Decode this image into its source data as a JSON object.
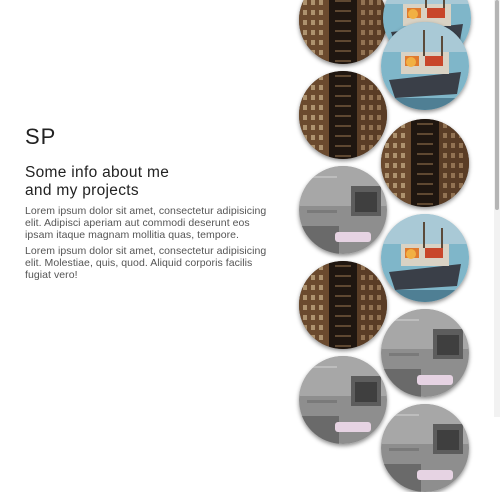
{
  "intro": {
    "initials": "SP",
    "subtitle_line1": "Some info about me",
    "subtitle_line2": "and my projects",
    "paragraph1": "Lorem ipsum dolor sit amet, consectetur adipisicing elit. Adipisci aperiam aut commodi deserunt eos ipsam itaque magnam mollitia quas, tempore.",
    "paragraph2": "Lorem ipsum dolor sit amet, consectetur adipisicing elit. Molestiae, quis, quod. Aliquid corporis facilis fugiat vero!"
  },
  "gallery": {
    "images": [
      {
        "name": "building-photo-1",
        "kind": "building"
      },
      {
        "name": "boat-photo-1",
        "kind": "boat"
      },
      {
        "name": "building-photo-2",
        "kind": "building"
      },
      {
        "name": "building-photo-3",
        "kind": "building"
      },
      {
        "name": "wall-photo-1",
        "kind": "wall"
      },
      {
        "name": "boat-photo-2",
        "kind": "boat"
      },
      {
        "name": "building-photo-4",
        "kind": "building"
      },
      {
        "name": "wall-photo-2",
        "kind": "wall"
      },
      {
        "name": "wall-photo-3",
        "kind": "wall"
      },
      {
        "name": "wall-photo-4",
        "kind": "wall"
      },
      {
        "name": "boat-photo-3",
        "kind": "boat"
      }
    ]
  }
}
